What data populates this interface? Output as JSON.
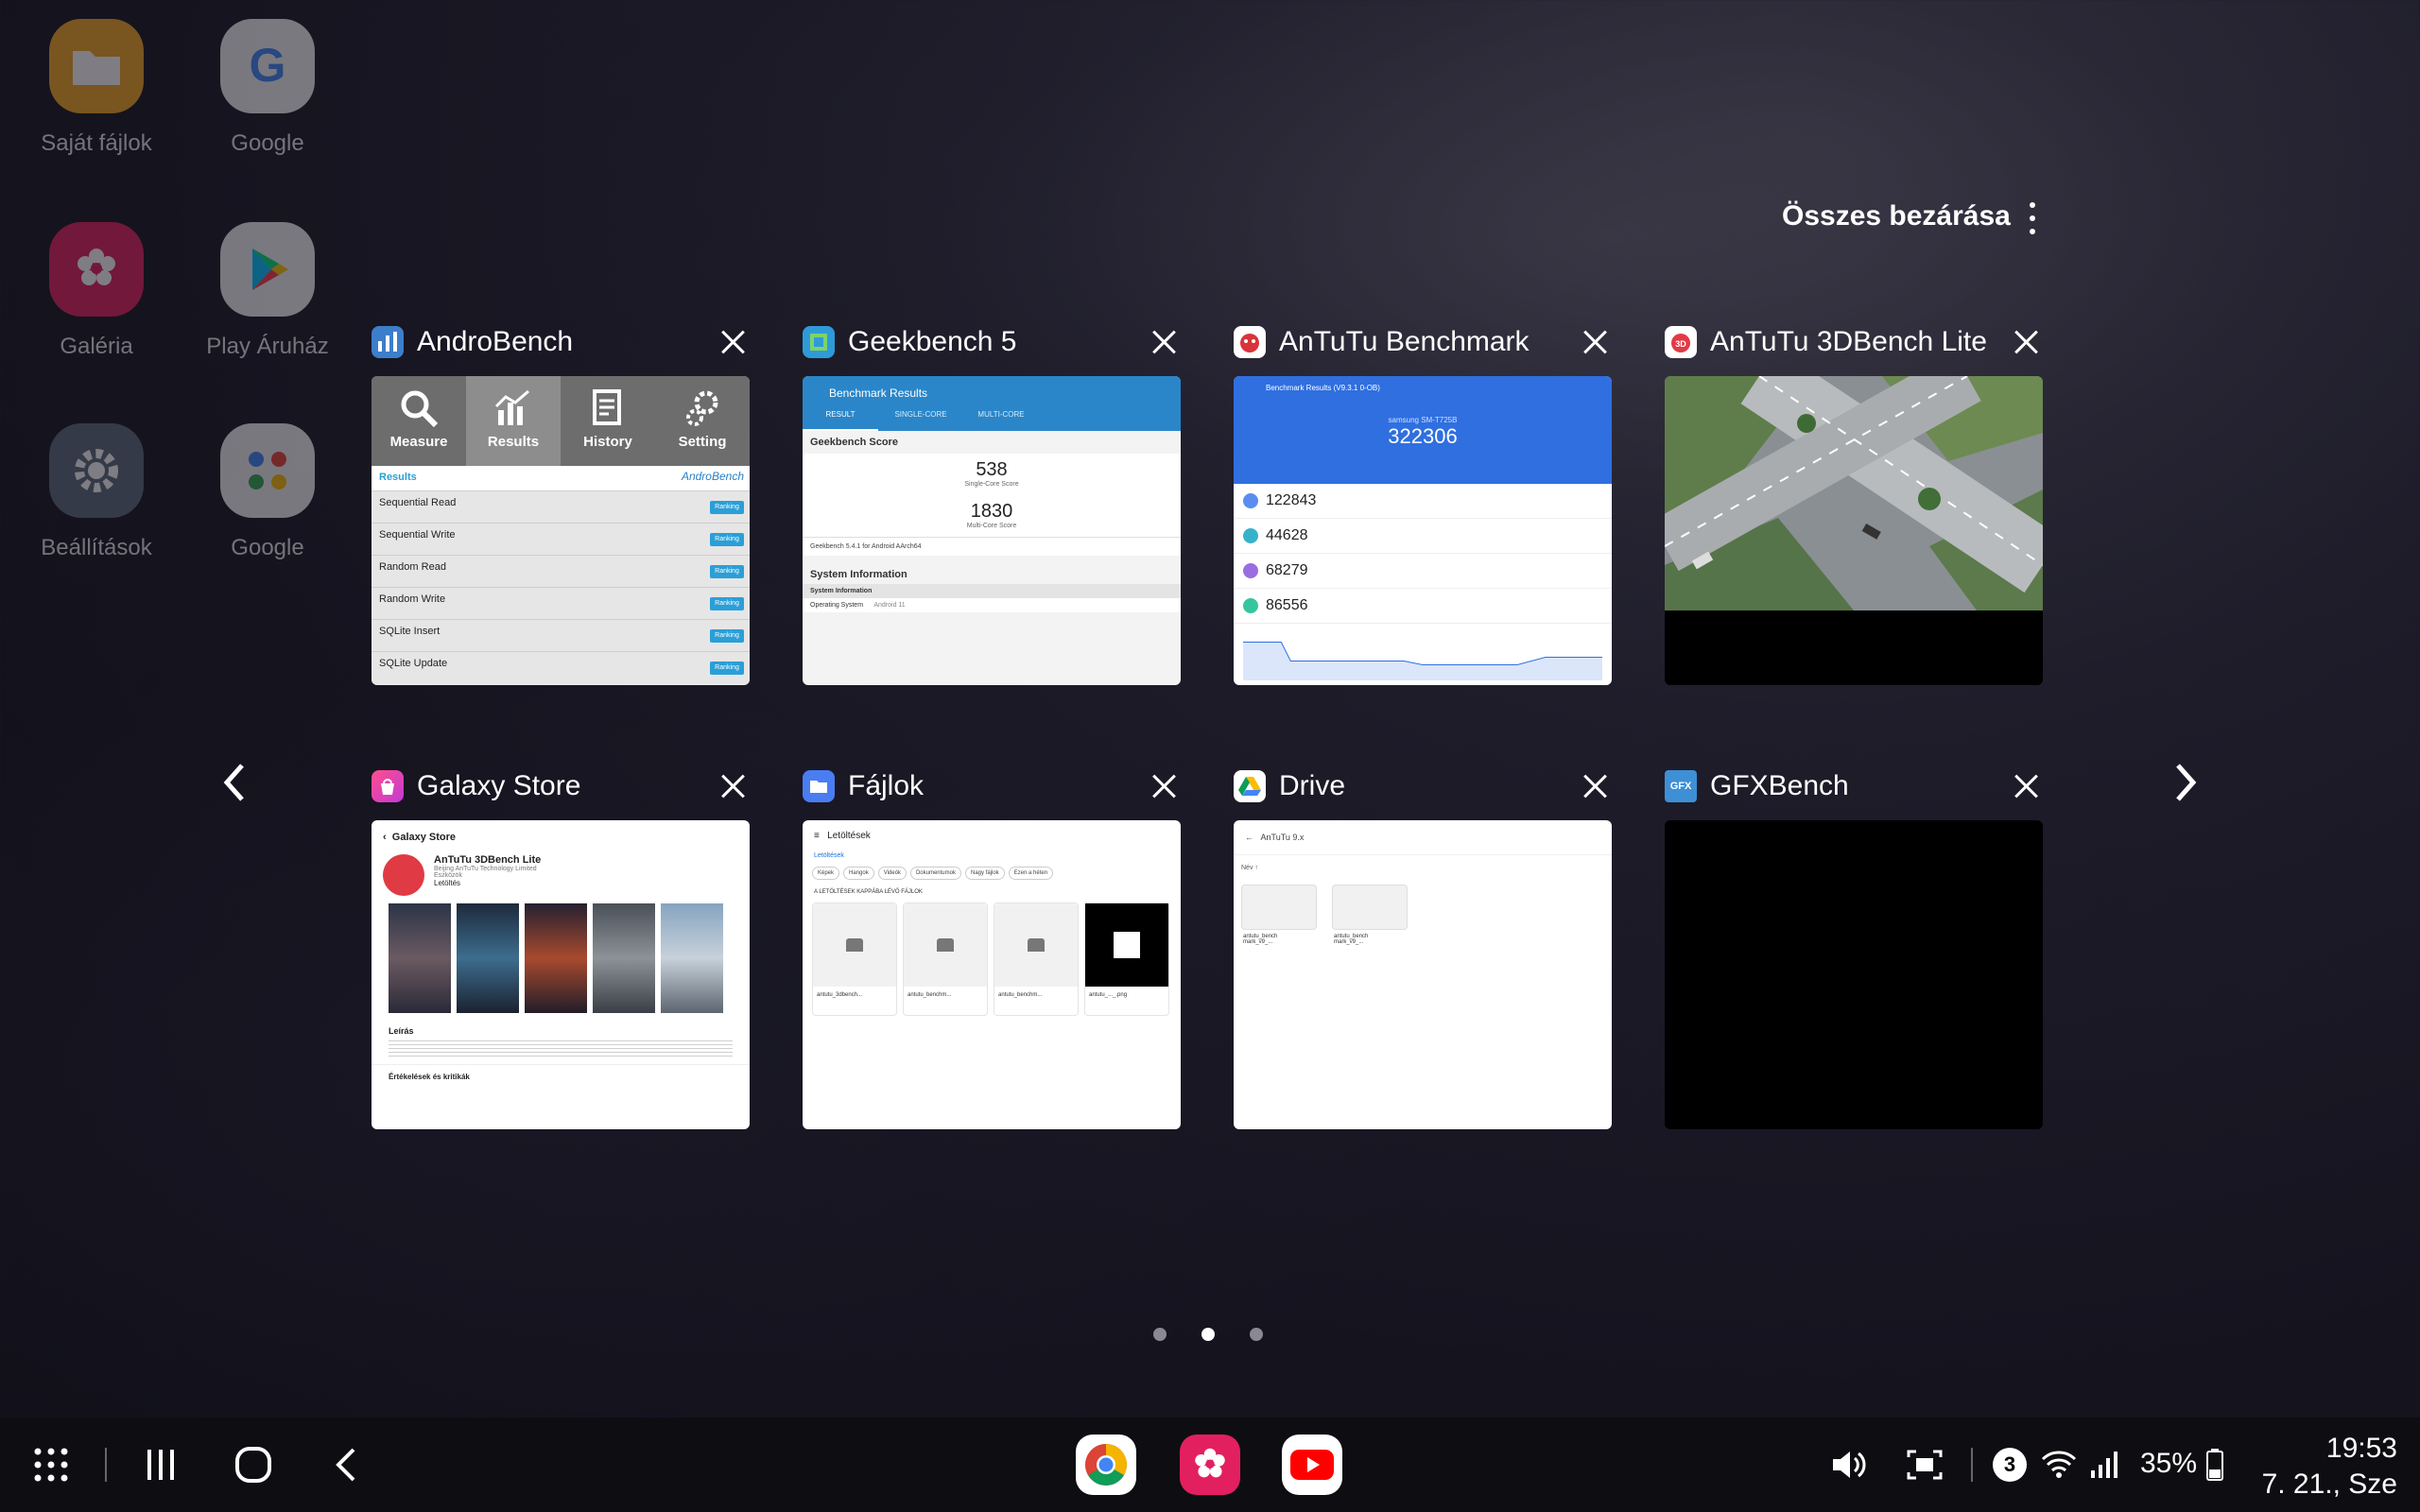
{
  "home": {
    "icons": [
      {
        "label": "Saját fájlok",
        "icon": "folder-icon",
        "color": "#f3a623"
      },
      {
        "label": "Google",
        "icon": "google-icon",
        "color": "#ffffff"
      },
      {
        "label": "Galéria",
        "icon": "gallery-flower-icon",
        "color": "#e3205f"
      },
      {
        "label": "Play Áruház",
        "icon": "play-store-icon",
        "color": "#ffffff"
      },
      {
        "label": "Beállítások",
        "icon": "gear-icon",
        "color": "#5b6b7a"
      },
      {
        "label": "Google",
        "icon": "google-apps-folder-icon",
        "color": "#ffffff"
      }
    ]
  },
  "recents": {
    "close_all_label": "Összes bezárása",
    "cards": [
      {
        "title": "AndroBench",
        "icon": "androbench-icon"
      },
      {
        "title": "Geekbench 5",
        "icon": "geekbench-icon"
      },
      {
        "title": "AnTuTu Benchmark",
        "icon": "antutu-icon"
      },
      {
        "title": "AnTuTu 3DBench Lite",
        "icon": "antutu-3dbench-icon"
      },
      {
        "title": "Galaxy Store",
        "icon": "galaxy-store-icon"
      },
      {
        "title": "Fájlok",
        "icon": "files-icon"
      },
      {
        "title": "Drive",
        "icon": "drive-icon"
      },
      {
        "title": "GFXBench",
        "icon": "gfxbench-icon"
      }
    ],
    "page_indicator": {
      "count": 3,
      "active": 2
    }
  },
  "androbench": {
    "tabs": [
      "Measure",
      "Results",
      "History",
      "Setting"
    ],
    "section": "Results",
    "logo": "AndroBench",
    "rows": [
      "Sequential Read",
      "Sequential Write",
      "Random Read",
      "Random Write",
      "SQLite Insert",
      "SQLite Update"
    ],
    "badge": "Ranking"
  },
  "geekbench": {
    "header": "Benchmark Results",
    "tabs": [
      "RESULT",
      "SINGLE-CORE",
      "MULTI-CORE"
    ],
    "score_title": "Geekbench Score",
    "single": "538",
    "single_label": "Single-Core Score",
    "multi": "1830",
    "multi_label": "Multi-Core Score",
    "version": "Geekbench 5.4.1 for Android AArch64",
    "sysinfo": "System Information",
    "sysinfo2": "System Information",
    "os_label": "Operating System",
    "os_value": "Android 11"
  },
  "antutu": {
    "header": "Benchmark Results (V9.3.1 0-OB)",
    "device": "samsung SM-T725B",
    "total": "322306",
    "subs": [
      "122843",
      "44628",
      "68279",
      "86556"
    ],
    "sub_colors": [
      "#5b8def",
      "#36b3c9",
      "#9a6de0",
      "#37c5a0"
    ]
  },
  "galaxystore": {
    "header": "Galaxy Store",
    "app": "AnTuTu 3DBench Lite",
    "publisher": "Beijing AnTuTu Technology Limited",
    "cat": "Eszközök",
    "install": "Letöltés",
    "desc_title": "Leírás",
    "reviews": "Értékelések és kritikák"
  },
  "files": {
    "header": "Letöltések",
    "crumb": "Letöltések",
    "chips": [
      "Képek",
      "Hangok",
      "Videók",
      "Dokumentumok",
      "Nagy fájlok",
      "Ezen a héten"
    ],
    "section": "A LETÖLTÉSEK KAPPÁBA LÉVŐ FÁJLOK",
    "items": [
      "antutu_3dbench...",
      "antutu_benchm...",
      "antutu_benchm...",
      "antutu_..._.png"
    ]
  },
  "drive": {
    "search": "AnTuTu 9.x",
    "sort": "Név ↑",
    "files": [
      "antutu_bench\nmark_v9_...",
      "antutu_bench\nmark_v9_..."
    ]
  },
  "taskbar": {
    "notification_count": "3",
    "battery": "35%",
    "time": "19:53",
    "date": "7. 21., Sze",
    "apps": [
      "chrome-icon",
      "gallery-icon",
      "youtube-icon"
    ]
  }
}
